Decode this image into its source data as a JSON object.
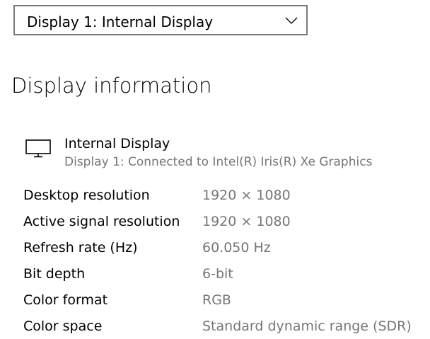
{
  "display_selector": {
    "selected": "Display 1: Internal Display",
    "chevron_icon": "chevron-down-icon"
  },
  "section": {
    "title": "Display information"
  },
  "display": {
    "icon": "monitor-icon",
    "name": "Internal Display",
    "connection": "Display 1: Connected to Intel(R) Iris(R) Xe Graphics"
  },
  "info_rows": [
    {
      "label": "Desktop resolution",
      "value": "1920 × 1080"
    },
    {
      "label": "Active signal resolution",
      "value": "1920 × 1080"
    },
    {
      "label": "Refresh rate (Hz)",
      "value": "60.050 Hz"
    },
    {
      "label": "Bit depth",
      "value": "6-bit"
    },
    {
      "label": "Color format",
      "value": "RGB"
    },
    {
      "label": "Color space",
      "value": "Standard dynamic range (SDR)"
    }
  ],
  "colors": {
    "border": "#7a7a7a",
    "secondary_text": "#767676",
    "primary_text": "#000000",
    "background": "#ffffff"
  }
}
